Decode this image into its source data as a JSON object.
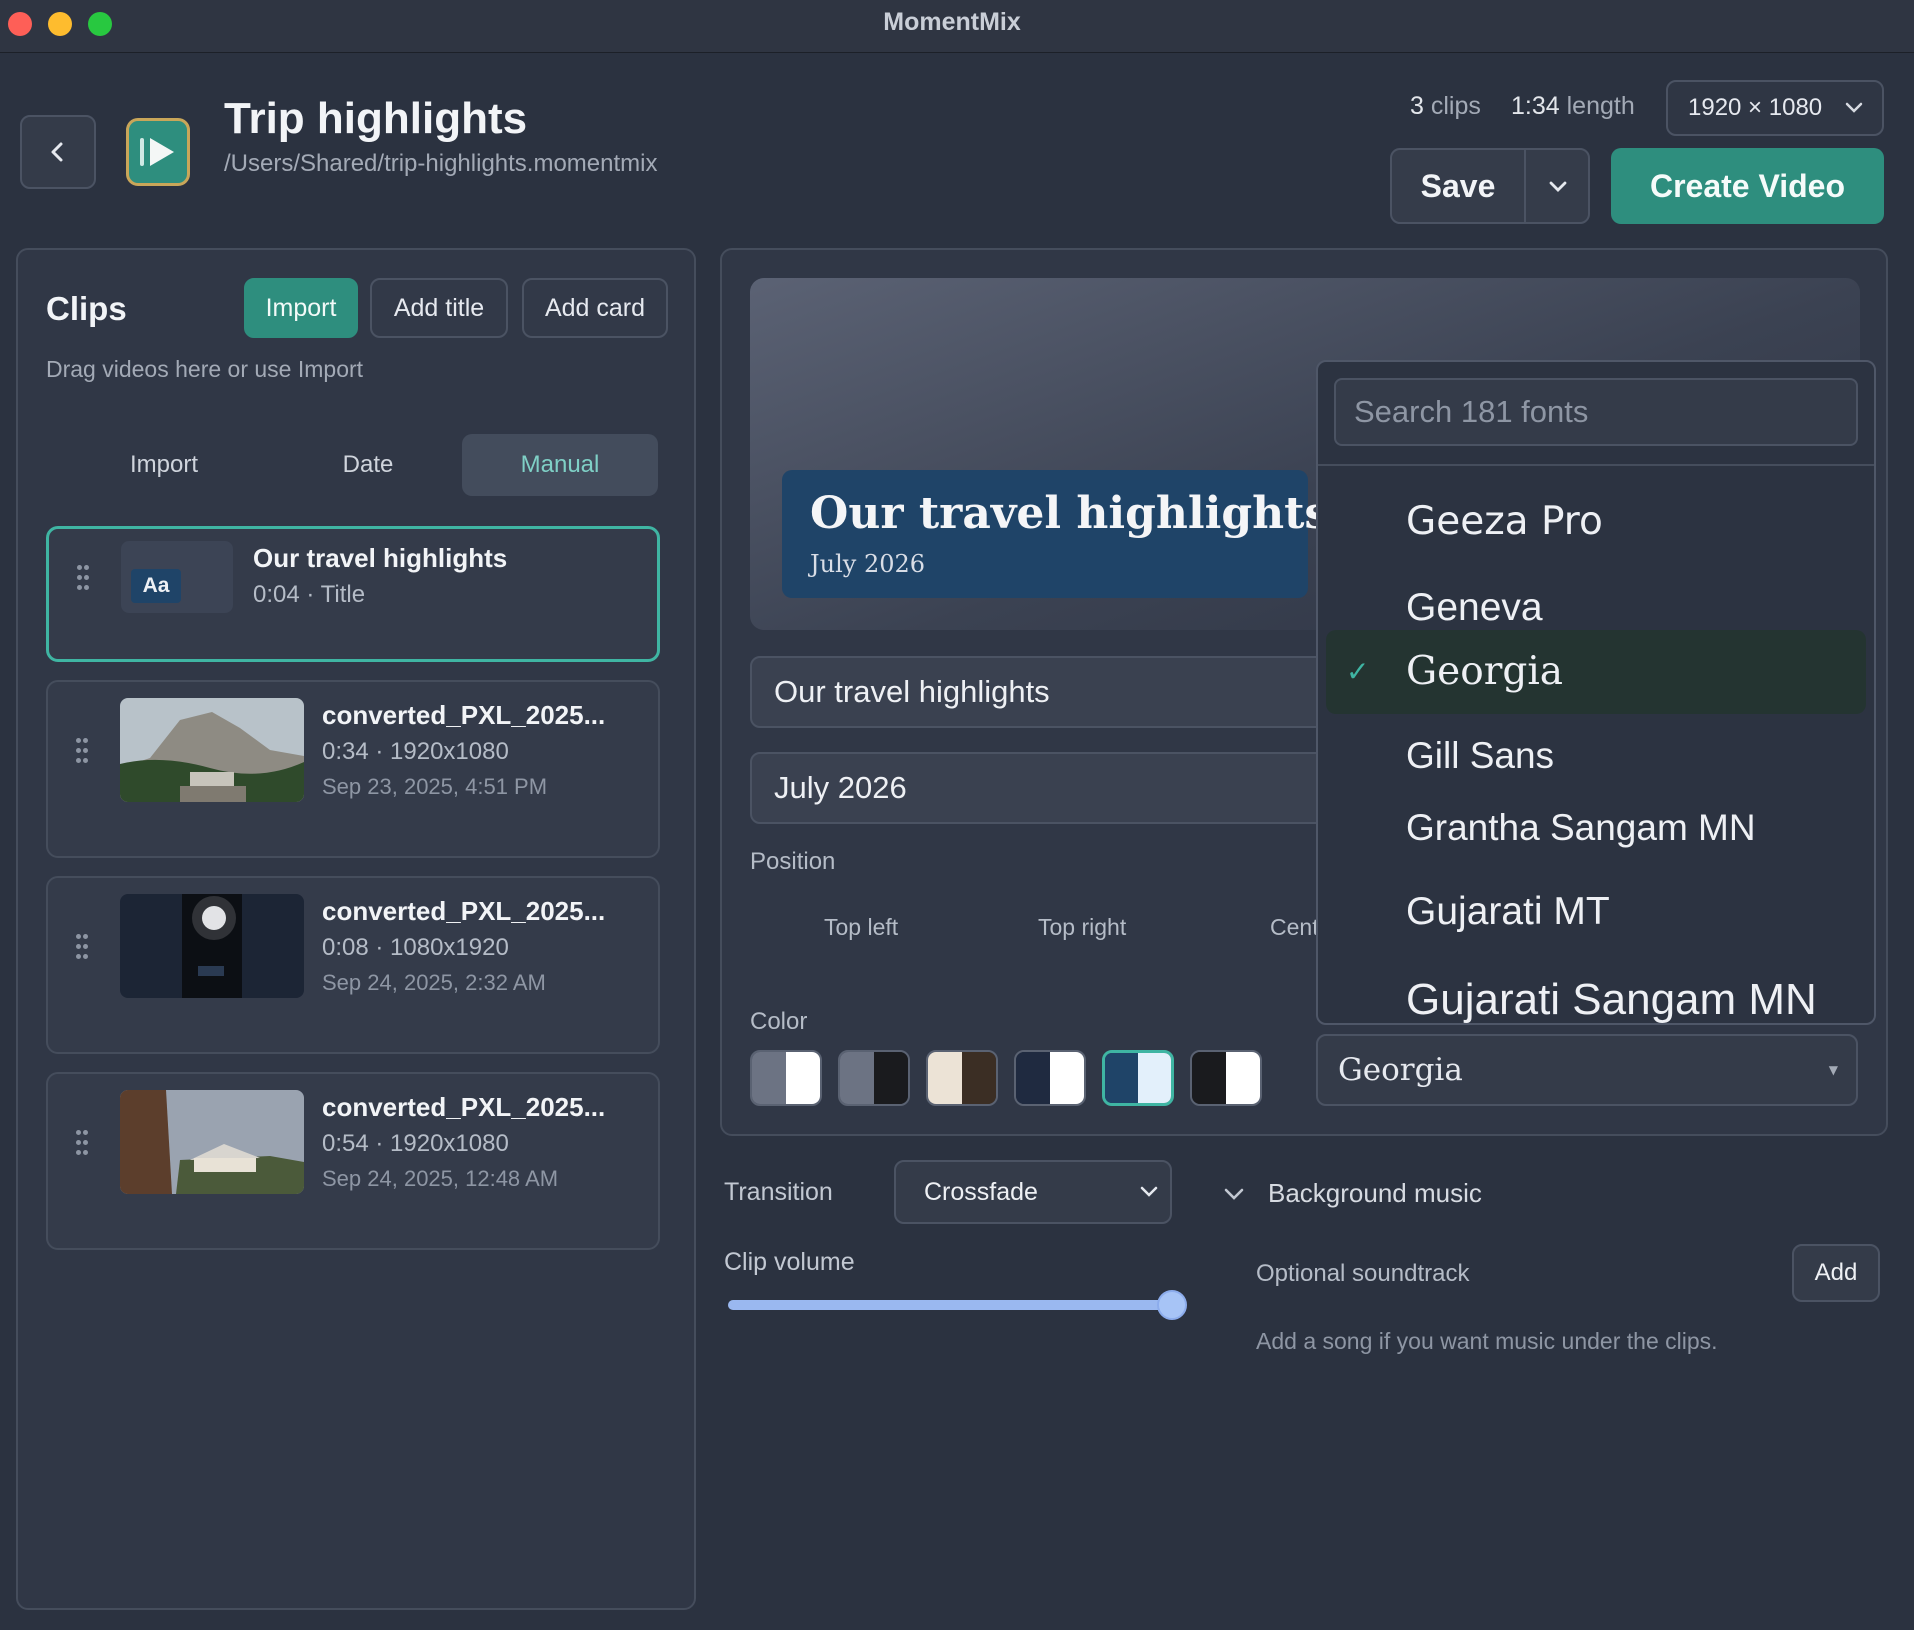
{
  "window": {
    "title": "MomentMix"
  },
  "header": {
    "title": "Trip highlights",
    "path": "/Users/Shared/trip-highlights.momentmix",
    "clips_count": "3",
    "clips_label": "clips",
    "length_value": "1:34",
    "length_label": "length",
    "resolution": "1920 × 1080",
    "save_label": "Save",
    "create_label": "Create Video"
  },
  "clips_panel": {
    "title": "Clips",
    "import_label": "Import",
    "add_title_label": "Add title",
    "add_card_label": "Add card",
    "hint": "Drag videos here or use Import",
    "sort_options": [
      "Import",
      "Date",
      "Manual"
    ],
    "sort_selected": "Manual",
    "items": [
      {
        "name": "Our travel highlights",
        "meta": "0:04 · Title",
        "badge": "Aa"
      },
      {
        "name": "converted_PXL_2025...",
        "meta": "0:34 · 1920x1080",
        "date": "Sep 23, 2025, 4:51 PM"
      },
      {
        "name": "converted_PXL_2025...",
        "meta": "0:08 · 1080x1920",
        "date": "Sep 24, 2025, 2:32 AM"
      },
      {
        "name": "converted_PXL_2025...",
        "meta": "0:54 · 1920x1080",
        "date": "Sep 24, 2025, 12:48 AM"
      }
    ]
  },
  "editor": {
    "preview_title": "Our travel highlights",
    "preview_subtitle": "July 2026",
    "title_value": "Our travel highlights",
    "subtitle_value": "July 2026",
    "position_label": "Position",
    "position_options": [
      "Top left",
      "Top right",
      "Cent"
    ],
    "color_label": "Color",
    "swatches": [
      {
        "left": "#6c7383",
        "right": "#ffffff"
      },
      {
        "left": "#6c7383",
        "right": "#1a1b1e"
      },
      {
        "left": "#ece3d6",
        "right": "#3b2e24"
      },
      {
        "left": "#1f2a40",
        "right": "#ffffff"
      },
      {
        "left": "#1f4468",
        "right": "#e3f0fb"
      },
      {
        "left": "#1a1b1e",
        "right": "#ffffff"
      }
    ],
    "selected_swatch": 4,
    "font_value": "Georgia",
    "font_search_placeholder": "Search 181 fonts",
    "font_list": [
      "Geeza Pro",
      "Geneva",
      "Georgia",
      "Gill Sans",
      "Grantha Sangam MN",
      "Gujarati MT",
      "Gujarati Sangam MN"
    ],
    "font_selected": "Georgia"
  },
  "lower": {
    "transition_label": "Transition",
    "transition_value": "Crossfade",
    "volume_label": "Clip volume",
    "volume_fraction": 1.0,
    "music_label": "Background music",
    "soundtrack_label": "Optional soundtrack",
    "add_label": "Add",
    "music_hint": "Add a song if you want music under the clips."
  },
  "colors": {
    "accent": "#2e8e7e",
    "selection": "#3fb5a3",
    "background": "#2b3240"
  }
}
